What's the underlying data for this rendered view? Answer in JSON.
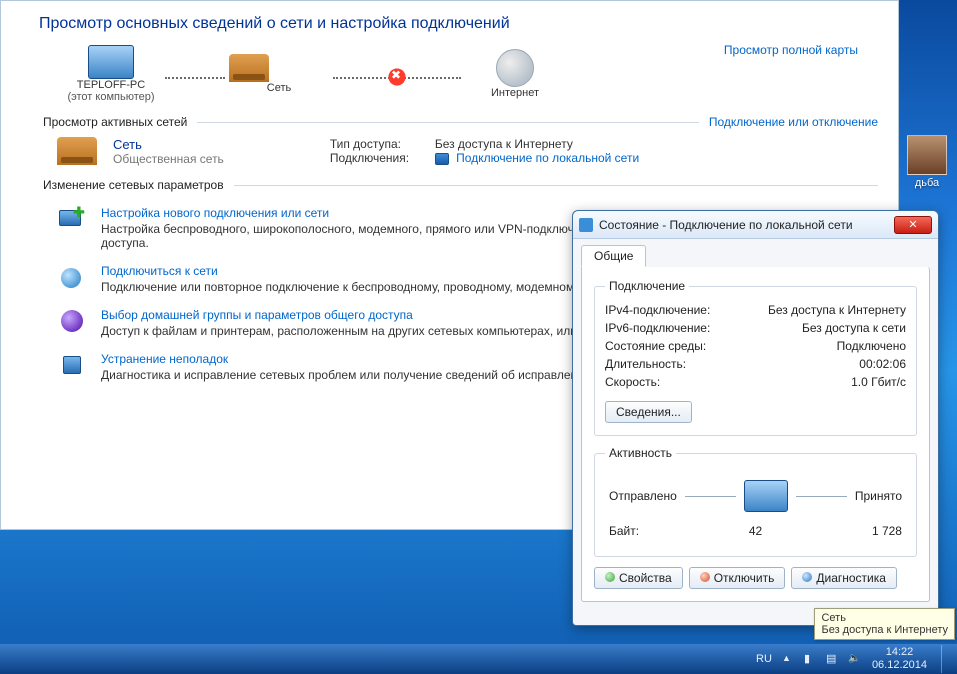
{
  "ncp": {
    "title": "Просмотр основных сведений о сети и настройка подключений",
    "fullmap_link": "Просмотр полной карты",
    "map": {
      "pc": "TEPLOFF-PC",
      "pc_sub": "(этот компьютер)",
      "mid": "Сеть",
      "inet": "Интернет"
    },
    "active_section": "Просмотр активных сетей",
    "connect_disconnect": "Подключение или отключение",
    "net": {
      "name": "Сеть",
      "type": "Общественная сеть",
      "access_k": "Тип доступа:",
      "access_v": "Без доступа к Интернету",
      "conn_k": "Подключения:",
      "conn_v": "Подключение по локальной сети"
    },
    "change_section": "Изменение сетевых параметров",
    "tasks": [
      {
        "link": "Настройка нового подключения или сети",
        "desc": "Настройка беспроводного, широкополосного, модемного, прямого или VPN-подключения или же настройка маршрутизатора или точки доступа."
      },
      {
        "link": "Подключиться к сети",
        "desc": "Подключение или повторное подключение к беспроводному, проводному, модемному сетевому соединению или подключение к VPN."
      },
      {
        "link": "Выбор домашней группы и параметров общего доступа",
        "desc": "Доступ к файлам и принтерам, расположенным на других сетевых компьютерах, или изменение параметров общего доступа."
      },
      {
        "link": "Устранение неполадок",
        "desc": "Диагностика и исправление сетевых проблем или получение сведений об исправлении."
      }
    ]
  },
  "status": {
    "title": "Состояние - Подключение по локальной сети",
    "tab": "Общие",
    "group_conn": "Подключение",
    "rows": {
      "ipv4_k": "IPv4-подключение:",
      "ipv4_v": "Без доступа к Интернету",
      "ipv6_k": "IPv6-подключение:",
      "ipv6_v": "Без доступа к сети",
      "media_k": "Состояние среды:",
      "media_v": "Подключено",
      "dur_k": "Длительность:",
      "dur_v": "00:02:06",
      "speed_k": "Скорость:",
      "speed_v": "1.0 Гбит/с"
    },
    "details_btn": "Сведения...",
    "group_act": "Активность",
    "sent": "Отправлено",
    "recv": "Принято",
    "bytes_k": "Байт:",
    "bytes_sent": "42",
    "bytes_recv": "1 728",
    "btn_props": "Свойства",
    "btn_disable": "Отключить",
    "btn_diag": "Диагностика"
  },
  "tooltip": {
    "line1": "Сеть",
    "line2": "Без доступа к Интернету"
  },
  "desktop_icon": "дьба",
  "taskbar": {
    "lang": "RU",
    "time": "14:22",
    "date": "06.12.2014"
  }
}
